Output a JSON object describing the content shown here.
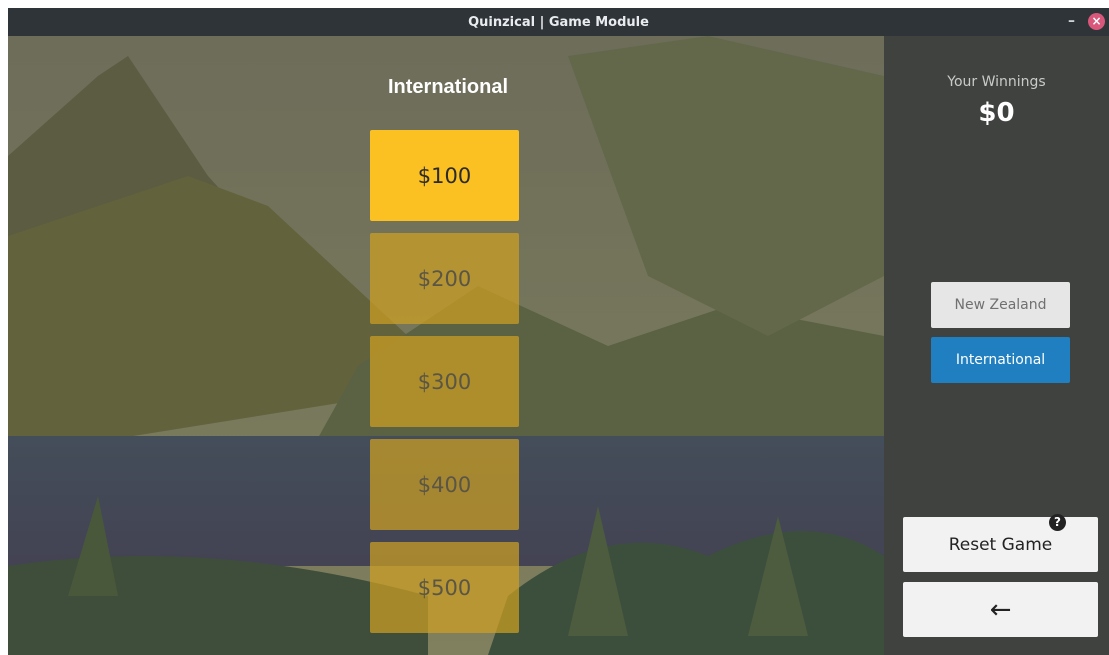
{
  "window": {
    "title": "Quinzical | Game Module",
    "minimize_glyph": "–",
    "close_glyph": "×"
  },
  "board": {
    "category": "International",
    "values": [
      {
        "label": "$100",
        "state": "active"
      },
      {
        "label": "$200",
        "state": "locked"
      },
      {
        "label": "$300",
        "state": "locked"
      },
      {
        "label": "$400",
        "state": "locked"
      },
      {
        "label": "$500",
        "state": "locked"
      }
    ]
  },
  "sidebar": {
    "winnings_label": "Your Winnings",
    "winnings_value": "$0",
    "categories": [
      {
        "label": "New Zealand",
        "selected": false
      },
      {
        "label": "International",
        "selected": true
      }
    ],
    "reset_label": "Reset Game",
    "help_glyph": "?",
    "back_glyph": "←"
  },
  "colors": {
    "active_tile": "#fbc021",
    "selected_category": "#1f7fc0",
    "sidebar_bg": "#3f423f",
    "titlebar_bg": "#2f3438"
  },
  "icons": [
    "help-icon",
    "back-arrow-icon",
    "minimize-icon",
    "close-icon"
  ]
}
